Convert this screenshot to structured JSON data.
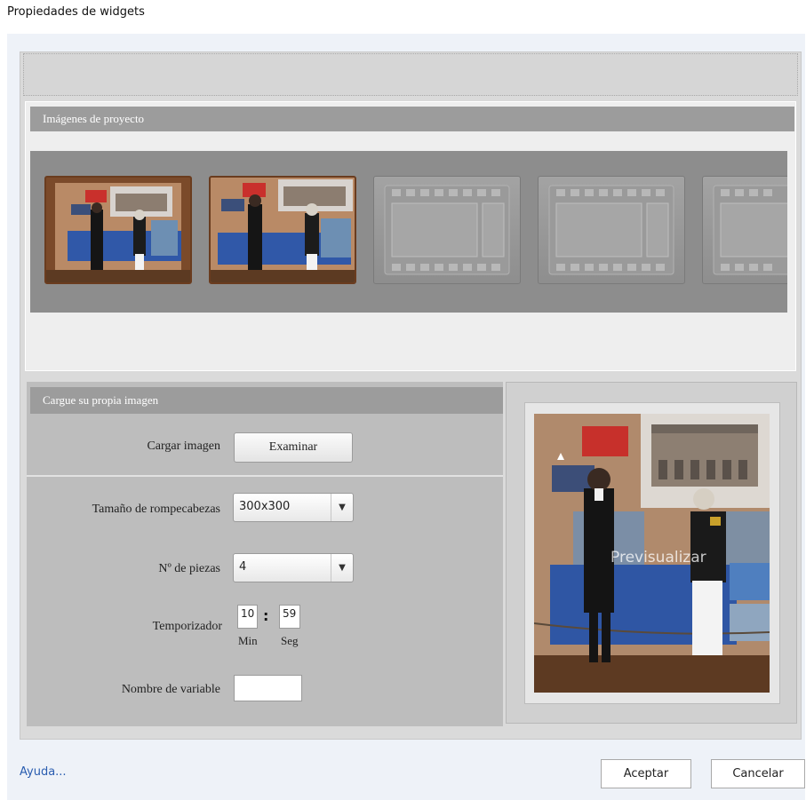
{
  "window": {
    "title": "Propiedades de widgets"
  },
  "images_section": {
    "header": "Imágenes de proyecto",
    "thumbnails": [
      {
        "kind": "photo"
      },
      {
        "kind": "photo"
      },
      {
        "kind": "empty"
      },
      {
        "kind": "empty"
      },
      {
        "kind": "empty"
      }
    ]
  },
  "upload_section": {
    "header": "Cargue su propia imagen",
    "load_image_label": "Cargar imagen",
    "browse_button": "Examinar",
    "size_label": "Tamaño de rompecabezas",
    "size_value": "300x300",
    "pieces_label": "Nº de piezas",
    "pieces_value": "4",
    "timer_label": "Temporizador",
    "timer_minutes": "10",
    "timer_separator": ":",
    "timer_seconds": "59",
    "min_caption": "Min",
    "seg_caption": "Seg",
    "variable_label": "Nombre de variable",
    "variable_value": ""
  },
  "preview": {
    "watermark": "Previsualizar"
  },
  "footer": {
    "help_link": "Ayuda...",
    "accept_button": "Aceptar",
    "cancel_button": "Cancelar"
  },
  "colors": {
    "section_header": "#9c9c9c",
    "strip_background": "#8d8d8d",
    "upload_panel": "#bdbdbd",
    "link": "#2a5db0"
  }
}
